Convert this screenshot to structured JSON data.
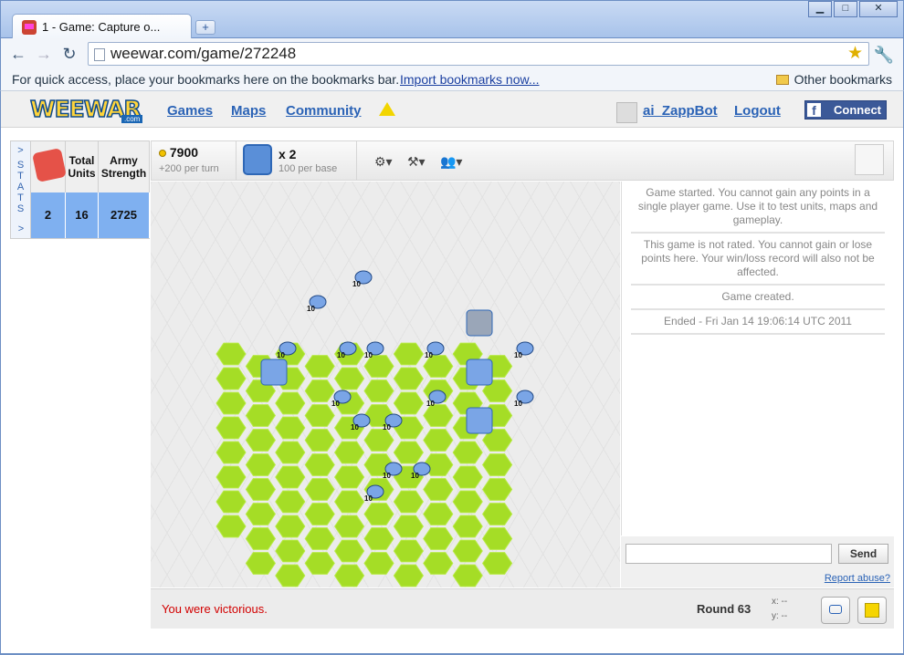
{
  "browser": {
    "tab_title": "1 - Game: Capture o...",
    "new_tab_label": "+",
    "url_host": "weewar.com",
    "url_path": "/game/272248",
    "url": "weewar.com/game/272248",
    "bookmarks_message": "For quick access, place your bookmarks here on the bookmarks bar.",
    "import_link": "Import bookmarks now...",
    "other_bookmarks": "Other bookmarks",
    "window_buttons": [
      "minimize",
      "maximize",
      "close"
    ]
  },
  "site": {
    "logo": "WEEWAR",
    "logo_suffix": ".com",
    "nav": [
      "Games",
      "Maps",
      "Community"
    ],
    "username": "ai_ZappBot",
    "logout": "Logout",
    "connect": "Connect"
  },
  "stats": {
    "side_label": "S T A T S",
    "arrow": ">",
    "headers": [
      "Total Units",
      "Army Strength"
    ],
    "values": {
      "place": "2",
      "units": "16",
      "strength": "2725"
    }
  },
  "game_bar": {
    "credits": "7900",
    "credits_per_turn": "+200 per turn",
    "bases": "x 2",
    "per_base": "100 per base"
  },
  "map": {
    "terrain_color": "#a5dd26",
    "player_color": "#7aa5e6",
    "unit_label": "10"
  },
  "log": {
    "entries": [
      "Game started. You cannot gain any points in a single player game. Use it to test units, maps and gameplay.",
      "This game is not rated. You cannot gain or lose points here. Your win/loss record will also not be affected.",
      "Game created.",
      "Ended - Fri Jan 14 19:06:14 UTC 2011"
    ]
  },
  "chat": {
    "placeholder": "",
    "send": "Send",
    "report": "Report abuse?"
  },
  "footer": {
    "status": "You were victorious.",
    "round": "Round 63",
    "x": "x: --",
    "y": "y: --"
  }
}
